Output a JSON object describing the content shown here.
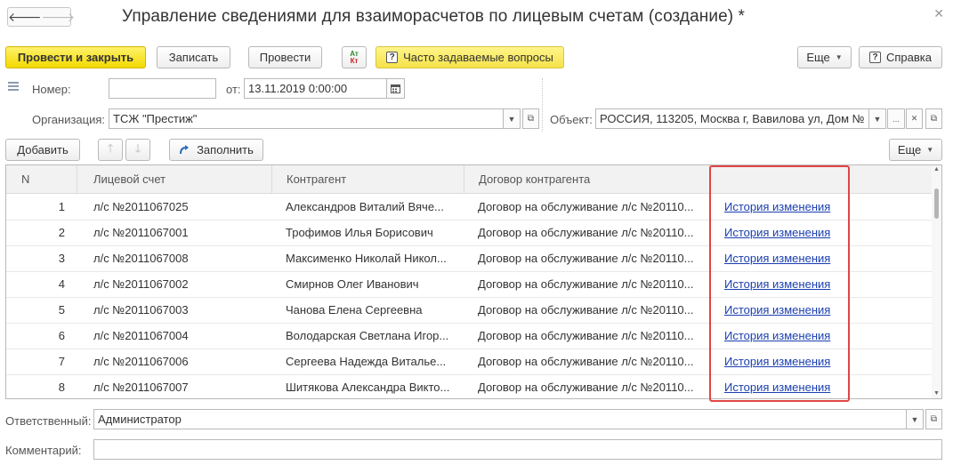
{
  "window": {
    "title": "Управление сведениями для взаиморасчетов по лицевым счетам (создание) *",
    "back_glyph": "🡐",
    "forward_glyph": "🡒",
    "close_glyph": "✕"
  },
  "toolbar": {
    "post_close": "Провести и закрыть",
    "save": "Записать",
    "post": "Провести",
    "dtkt_top": "Ат",
    "dtkt_bottom": "Кт",
    "faq": "Часто задаваемые вопросы",
    "more": "Еще",
    "help": "Справка",
    "help_icon": "?"
  },
  "form": {
    "number_label": "Номер:",
    "number_value": "",
    "from_label": "от:",
    "date_value": "13.11.2019  0:00:00",
    "org_label": "Организация:",
    "org_value": "ТСЖ \"Престиж\"",
    "object_label": "Объект:",
    "object_value": "РОССИЯ, 113205, Москва г, Вавилова ул, Дом №",
    "ellipsis": "...",
    "responsible_label": "Ответственный:",
    "responsible_value": "Администратор",
    "comment_label": "Комментарий:",
    "comment_value": ""
  },
  "table_toolbar": {
    "add": "Добавить",
    "fill": "Заполнить",
    "more": "Еще"
  },
  "table": {
    "columns": [
      "N",
      "Лицевой счет",
      "Контрагент",
      "Договор контрагента",
      ""
    ],
    "rows": [
      {
        "n": "1",
        "account": "л/с №2011067025",
        "counterparty": "Александров Виталий Вяче...",
        "contract": "Договор на обслуживание л/с №20110...",
        "link": "История изменения"
      },
      {
        "n": "2",
        "account": "л/с №2011067001",
        "counterparty": "Трофимов Илья Борисович",
        "contract": "Договор на обслуживание л/с №20110...",
        "link": "История изменения"
      },
      {
        "n": "3",
        "account": "л/с №2011067008",
        "counterparty": "Максименко Николай Никол...",
        "contract": "Договор на обслуживание л/с №20110...",
        "link": "История изменения"
      },
      {
        "n": "4",
        "account": "л/с №2011067002",
        "counterparty": "Смирнов Олег Иванович",
        "contract": "Договор на обслуживание л/с №20110...",
        "link": "История изменения"
      },
      {
        "n": "5",
        "account": "л/с №2011067003",
        "counterparty": "Чанова Елена Сергеевна",
        "contract": "Договор на обслуживание л/с №20110...",
        "link": "История изменения"
      },
      {
        "n": "6",
        "account": "л/с №2011067004",
        "counterparty": "Володарская Светлана Игор...",
        "contract": "Договор на обслуживание л/с №20110...",
        "link": "История изменения"
      },
      {
        "n": "7",
        "account": "л/с №2011067006",
        "counterparty": "Сергеева Надежда Виталье...",
        "contract": "Договор на обслуживание л/с №20110...",
        "link": "История изменения"
      },
      {
        "n": "8",
        "account": "л/с №2011067007",
        "counterparty": "Шитякова Александра Викто...",
        "contract": "Договор на обслуживание л/с №20110...",
        "link": "История изменения"
      }
    ]
  },
  "colors": {
    "primary_button": "#f2d900",
    "link": "#1a3fb0",
    "highlight": "#e04545"
  }
}
